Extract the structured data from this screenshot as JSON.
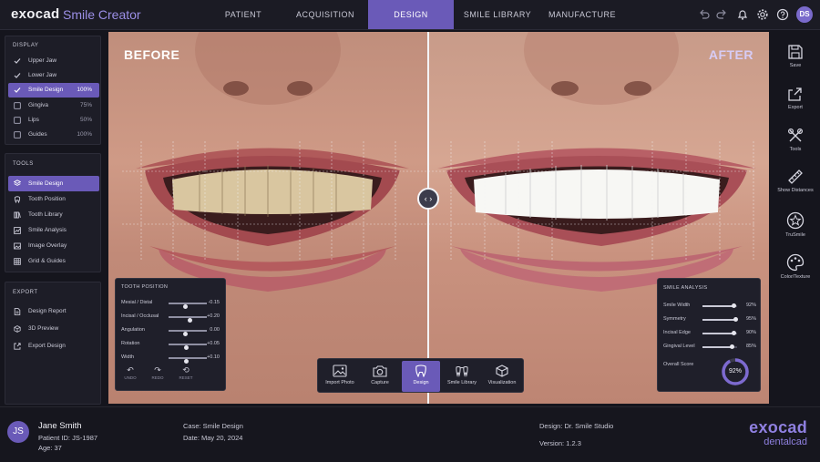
{
  "header": {
    "brand": "exocad",
    "app_title": "Smile Creator",
    "tabs": [
      {
        "label": "PATIENT"
      },
      {
        "label": "ACQUISITION"
      },
      {
        "label": "DESIGN",
        "active": true
      },
      {
        "label": "SMILE LIBRARY"
      },
      {
        "label": "MANUFACTURE"
      }
    ],
    "user_initials": "DS",
    "icons": [
      "undo-icon",
      "redo-icon",
      "bell-icon",
      "gear-icon",
      "help-icon"
    ]
  },
  "display": {
    "title": "DISPLAY",
    "items": [
      {
        "label": "Upper Jaw",
        "value": "",
        "icon": "check-icon"
      },
      {
        "label": "Lower Jaw",
        "value": "",
        "icon": "check-icon"
      },
      {
        "label": "Smile Design",
        "value": "100%",
        "icon": "check-icon",
        "selected": true
      },
      {
        "label": "Gingiva",
        "value": "75%",
        "icon": "checkbox-icon"
      },
      {
        "label": "Lips",
        "value": "50%",
        "icon": "checkbox-icon"
      },
      {
        "label": "Guides",
        "value": "100%",
        "icon": "checkbox-icon"
      }
    ]
  },
  "tools": {
    "title": "TOOLS",
    "items": [
      {
        "label": "Smile Design",
        "icon": "layers-icon",
        "selected": true
      },
      {
        "label": "Tooth Position",
        "icon": "tooth-icon"
      },
      {
        "label": "Tooth Library",
        "icon": "library-icon"
      },
      {
        "label": "Smile Analysis",
        "icon": "analysis-icon"
      },
      {
        "label": "Image Overlay",
        "icon": "image-icon"
      },
      {
        "label": "Grid & Guides",
        "icon": "grid-icon"
      }
    ]
  },
  "export": {
    "title": "EXPORT",
    "items": [
      {
        "label": "Design Report",
        "icon": "document-icon"
      },
      {
        "label": "3D Preview",
        "icon": "cube-icon"
      },
      {
        "label": "Export Design",
        "icon": "export-icon"
      }
    ]
  },
  "viewport": {
    "before_label": "BEFORE",
    "after_label": "AFTER"
  },
  "tooth_position": {
    "title": "TOOTH POSITION",
    "rows": [
      {
        "label": "Mesial / Distal",
        "value": "-0.15",
        "level": 0.45
      },
      {
        "label": "Incisal / Occlusal",
        "value": "+0.20",
        "level": 0.55
      },
      {
        "label": "Angulation",
        "value": "0.00",
        "level": 0.45
      },
      {
        "label": "Rotation",
        "value": "+0.05",
        "level": 0.47
      },
      {
        "label": "Width",
        "value": "+0.10",
        "level": 0.47
      }
    ],
    "buttons": [
      {
        "label": "UNDO",
        "glyph": "↶"
      },
      {
        "label": "REDO",
        "glyph": "↷"
      },
      {
        "label": "RESET",
        "glyph": "⟲"
      }
    ]
  },
  "bottom_toolbar": {
    "items": [
      {
        "label": "Import Photo",
        "icon": "image-icon"
      },
      {
        "label": "Capture",
        "icon": "camera-icon"
      },
      {
        "label": "Design",
        "icon": "tooth-icon",
        "active": true
      },
      {
        "label": "Smile Library",
        "icon": "library-icon"
      },
      {
        "label": "Visualization",
        "icon": "cube-icon"
      }
    ]
  },
  "smile_analysis": {
    "title": "SMILE ANALYSIS",
    "rows": [
      {
        "label": "Smile Width",
        "value": "92%",
        "level": 0.92
      },
      {
        "label": "Symmetry",
        "value": "95%",
        "level": 0.95
      },
      {
        "label": "Incisal Edge",
        "value": "90%",
        "level": 0.9
      },
      {
        "label": "Gingival Level",
        "value": "85%",
        "level": 0.85
      }
    ],
    "overall_label": "Overall Score",
    "overall_value": "92%",
    "overall_level": 0.92
  },
  "right_toolbar": {
    "items": [
      {
        "label": "Save",
        "icon": "save-icon"
      },
      {
        "label": "Export",
        "icon": "export-icon"
      },
      {
        "label": "Tools",
        "icon": "tools-icon"
      },
      {
        "label": "Show Distances",
        "icon": "ruler-icon"
      },
      {
        "label": "TruSmile",
        "icon": "trusmile-icon"
      },
      {
        "label": "Color/Texture",
        "icon": "palette-icon"
      }
    ]
  },
  "footer": {
    "avatar_initials": "JS",
    "patient_name": "Jane Smith",
    "patient_id": "Patient ID: JS-1987",
    "age": "Age: 37",
    "case": "Case:  Smile Design",
    "date": "Date:  May 20, 2024",
    "designer": "Design:  Dr. Smile Studio",
    "version": "Version:  1.2.3",
    "logo_main": "exocad",
    "logo_sub": "dentalcad"
  }
}
